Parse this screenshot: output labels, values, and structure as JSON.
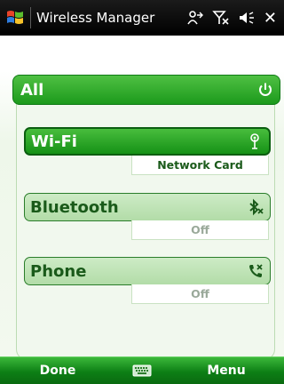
{
  "titlebar": {
    "title": "Wireless Manager",
    "icons": [
      "windows-start-icon",
      "connectivity-icon",
      "signal-off-icon",
      "volume-icon",
      "close-icon"
    ],
    "close_label": "✕"
  },
  "all": {
    "label": "All",
    "icon": "power-icon"
  },
  "devices": [
    {
      "label": "Wi-Fi",
      "icon": "wifi-antenna-icon",
      "status": "Network Card",
      "state": "on"
    },
    {
      "label": "Bluetooth",
      "icon": "bluetooth-off-icon",
      "status": "Off",
      "state": "off"
    },
    {
      "label": "Phone",
      "icon": "phone-off-icon",
      "status": "Off",
      "state": "off"
    }
  ],
  "menubar": {
    "left": "Done",
    "right": "Menu",
    "middle_icon": "keyboard-icon"
  },
  "colors": {
    "accent": "#1c9a1c",
    "dark_green": "#0b5e10",
    "light_green": "#cdebc6"
  }
}
